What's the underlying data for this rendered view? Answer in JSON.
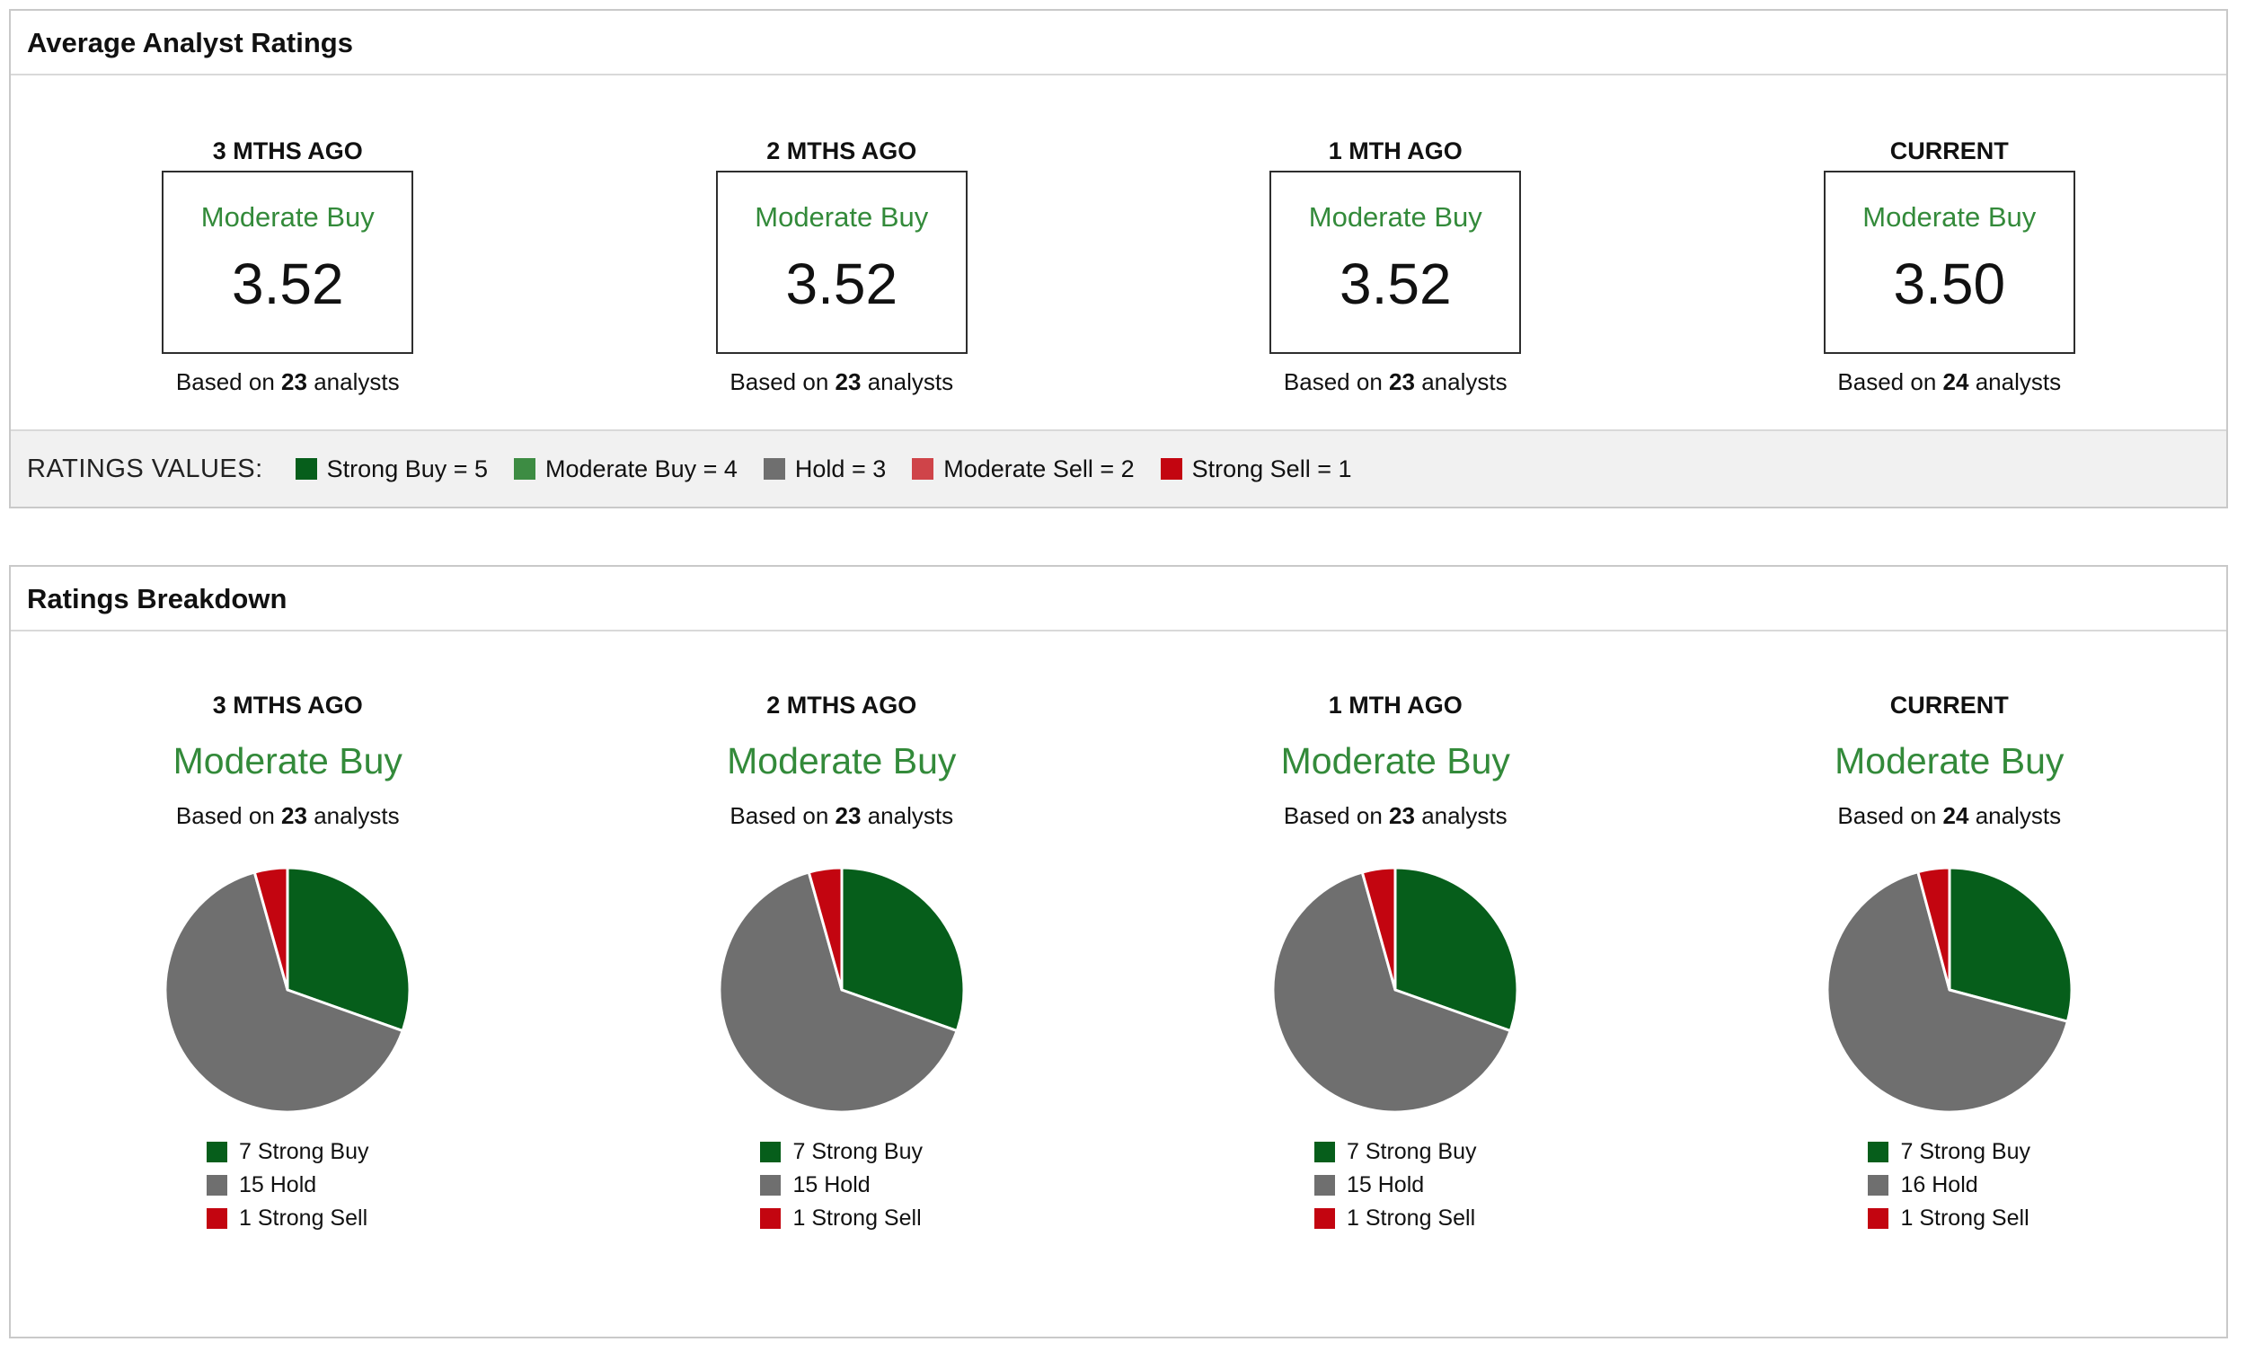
{
  "palette": {
    "strong_buy": "#065e1b",
    "moderate_buy": "#3d8c43",
    "hold": "#6f6f6f",
    "moderate_sell": "#cf4449",
    "strong_sell": "#c30510",
    "rating_text_green": "#338a3a"
  },
  "average_panel": {
    "title": "Average Analyst Ratings",
    "columns": [
      {
        "period": "3 MTHS AGO",
        "rating": "Moderate Buy",
        "value": "3.52",
        "based_prefix": "Based on",
        "analysts": "23",
        "based_suffix": "analysts"
      },
      {
        "period": "2 MTHS AGO",
        "rating": "Moderate Buy",
        "value": "3.52",
        "based_prefix": "Based on",
        "analysts": "23",
        "based_suffix": "analysts"
      },
      {
        "period": "1 MTH AGO",
        "rating": "Moderate Buy",
        "value": "3.52",
        "based_prefix": "Based on",
        "analysts": "23",
        "based_suffix": "analysts"
      },
      {
        "period": "CURRENT",
        "rating": "Moderate Buy",
        "value": "3.50",
        "based_prefix": "Based on",
        "analysts": "24",
        "based_suffix": "analysts"
      }
    ],
    "values_legend": {
      "label": "RATINGS VALUES:",
      "items": [
        {
          "label": "Strong Buy = 5",
          "color": "#065e1b"
        },
        {
          "label": "Moderate Buy = 4",
          "color": "#3d8c43"
        },
        {
          "label": "Hold = 3",
          "color": "#6f6f6f"
        },
        {
          "label": "Moderate Sell = 2",
          "color": "#cf4449"
        },
        {
          "label": "Strong Sell = 1",
          "color": "#c30510"
        }
      ]
    }
  },
  "breakdown_panel": {
    "title": "Ratings Breakdown"
  },
  "chart_data": [
    {
      "type": "pie",
      "period": "3 MTHS AGO",
      "rating": "Moderate Buy",
      "based_prefix": "Based on",
      "analysts": "23",
      "based_suffix": "analysts",
      "start_angle": "top",
      "direction": "clockwise",
      "legend_position": "bottom",
      "slices": [
        {
          "name": "Strong Buy",
          "label": "7 Strong Buy",
          "value": 7,
          "color": "#065e1b"
        },
        {
          "name": "Hold",
          "label": "15 Hold",
          "value": 15,
          "color": "#6f6f6f"
        },
        {
          "name": "Strong Sell",
          "label": "1 Strong Sell",
          "value": 1,
          "color": "#c30510"
        }
      ]
    },
    {
      "type": "pie",
      "period": "2 MTHS AGO",
      "rating": "Moderate Buy",
      "based_prefix": "Based on",
      "analysts": "23",
      "based_suffix": "analysts",
      "start_angle": "top",
      "direction": "clockwise",
      "legend_position": "bottom",
      "slices": [
        {
          "name": "Strong Buy",
          "label": "7 Strong Buy",
          "value": 7,
          "color": "#065e1b"
        },
        {
          "name": "Hold",
          "label": "15 Hold",
          "value": 15,
          "color": "#6f6f6f"
        },
        {
          "name": "Strong Sell",
          "label": "1 Strong Sell",
          "value": 1,
          "color": "#c30510"
        }
      ]
    },
    {
      "type": "pie",
      "period": "1 MTH AGO",
      "rating": "Moderate Buy",
      "based_prefix": "Based on",
      "analysts": "23",
      "based_suffix": "analysts",
      "start_angle": "top",
      "direction": "clockwise",
      "legend_position": "bottom",
      "slices": [
        {
          "name": "Strong Buy",
          "label": "7 Strong Buy",
          "value": 7,
          "color": "#065e1b"
        },
        {
          "name": "Hold",
          "label": "15 Hold",
          "value": 15,
          "color": "#6f6f6f"
        },
        {
          "name": "Strong Sell",
          "label": "1 Strong Sell",
          "value": 1,
          "color": "#c30510"
        }
      ]
    },
    {
      "type": "pie",
      "period": "CURRENT",
      "rating": "Moderate Buy",
      "based_prefix": "Based on",
      "analysts": "24",
      "based_suffix": "analysts",
      "start_angle": "top",
      "direction": "clockwise",
      "legend_position": "bottom",
      "slices": [
        {
          "name": "Strong Buy",
          "label": "7 Strong Buy",
          "value": 7,
          "color": "#065e1b"
        },
        {
          "name": "Hold",
          "label": "16 Hold",
          "value": 16,
          "color": "#6f6f6f"
        },
        {
          "name": "Strong Sell",
          "label": "1 Strong Sell",
          "value": 1,
          "color": "#c30510"
        }
      ]
    }
  ]
}
